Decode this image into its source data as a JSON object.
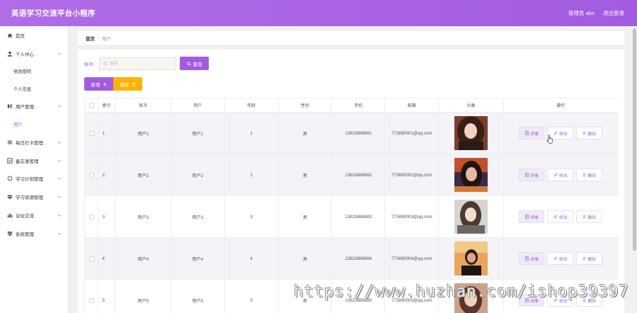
{
  "header": {
    "title": "英语学习交流平台小程序",
    "admin_label": "管理员 abo",
    "logout_label": "退出登录"
  },
  "sidebar": {
    "items": [
      {
        "label": "首页",
        "icon": "home-icon"
      },
      {
        "label": "个人中心",
        "icon": "user-icon",
        "expanded": true,
        "children": [
          {
            "label": "修改密码"
          },
          {
            "label": "个人信息"
          }
        ]
      },
      {
        "label": "用户管理",
        "icon": "users-icon",
        "expanded": true,
        "children": [
          {
            "label": "用户",
            "active": true
          }
        ]
      },
      {
        "label": "每日打卡管理",
        "icon": "list-icon"
      },
      {
        "label": "备忘录管理",
        "icon": "checkbox-icon"
      },
      {
        "label": "学习计划管理",
        "icon": "circle-icon"
      },
      {
        "label": "学习资源管理",
        "icon": "folder-icon"
      },
      {
        "label": "论坛交流",
        "icon": "chart-icon"
      },
      {
        "label": "系统管理",
        "icon": "settings-icon"
      }
    ]
  },
  "breadcrumb": {
    "home": "首页",
    "separator": "/",
    "current": "用户"
  },
  "search": {
    "label": "账号",
    "placeholder": "账号",
    "button_label": "查询"
  },
  "actions": {
    "add_label": "新增",
    "delete_label": "删除"
  },
  "table": {
    "columns": [
      "索引",
      "账号",
      "用户",
      "年龄",
      "性别",
      "手机",
      "邮箱",
      "头像",
      "操作"
    ],
    "rows": [
      {
        "index": "1",
        "account": "用户1",
        "user": "用户1",
        "age": "1",
        "gender": "男",
        "phone": "13823888881",
        "email": "773890001@qq.com"
      },
      {
        "index": "2",
        "account": "用户2",
        "user": "用户2",
        "age": "2",
        "gender": "男",
        "phone": "13823888882",
        "email": "773890002@qq.com"
      },
      {
        "index": "3",
        "account": "用户3",
        "user": "用户3",
        "age": "3",
        "gender": "男",
        "phone": "13823888883",
        "email": "773890003@qq.com"
      },
      {
        "index": "4",
        "account": "用户4",
        "user": "用户4",
        "age": "4",
        "gender": "男",
        "phone": "13823888884",
        "email": "773890004@qq.com"
      },
      {
        "index": "5",
        "account": "用户5",
        "user": "用户5",
        "age": "5",
        "gender": "男",
        "phone": "13823888885",
        "email": "773890005@qq.com"
      }
    ],
    "row_actions": {
      "detail": "详情",
      "edit": "修改",
      "delete": "删除"
    }
  },
  "watermark": "https://www.huzhan.com/ishop39397",
  "colors": {
    "accent": "#a35be0",
    "warning": "#ffb200"
  }
}
